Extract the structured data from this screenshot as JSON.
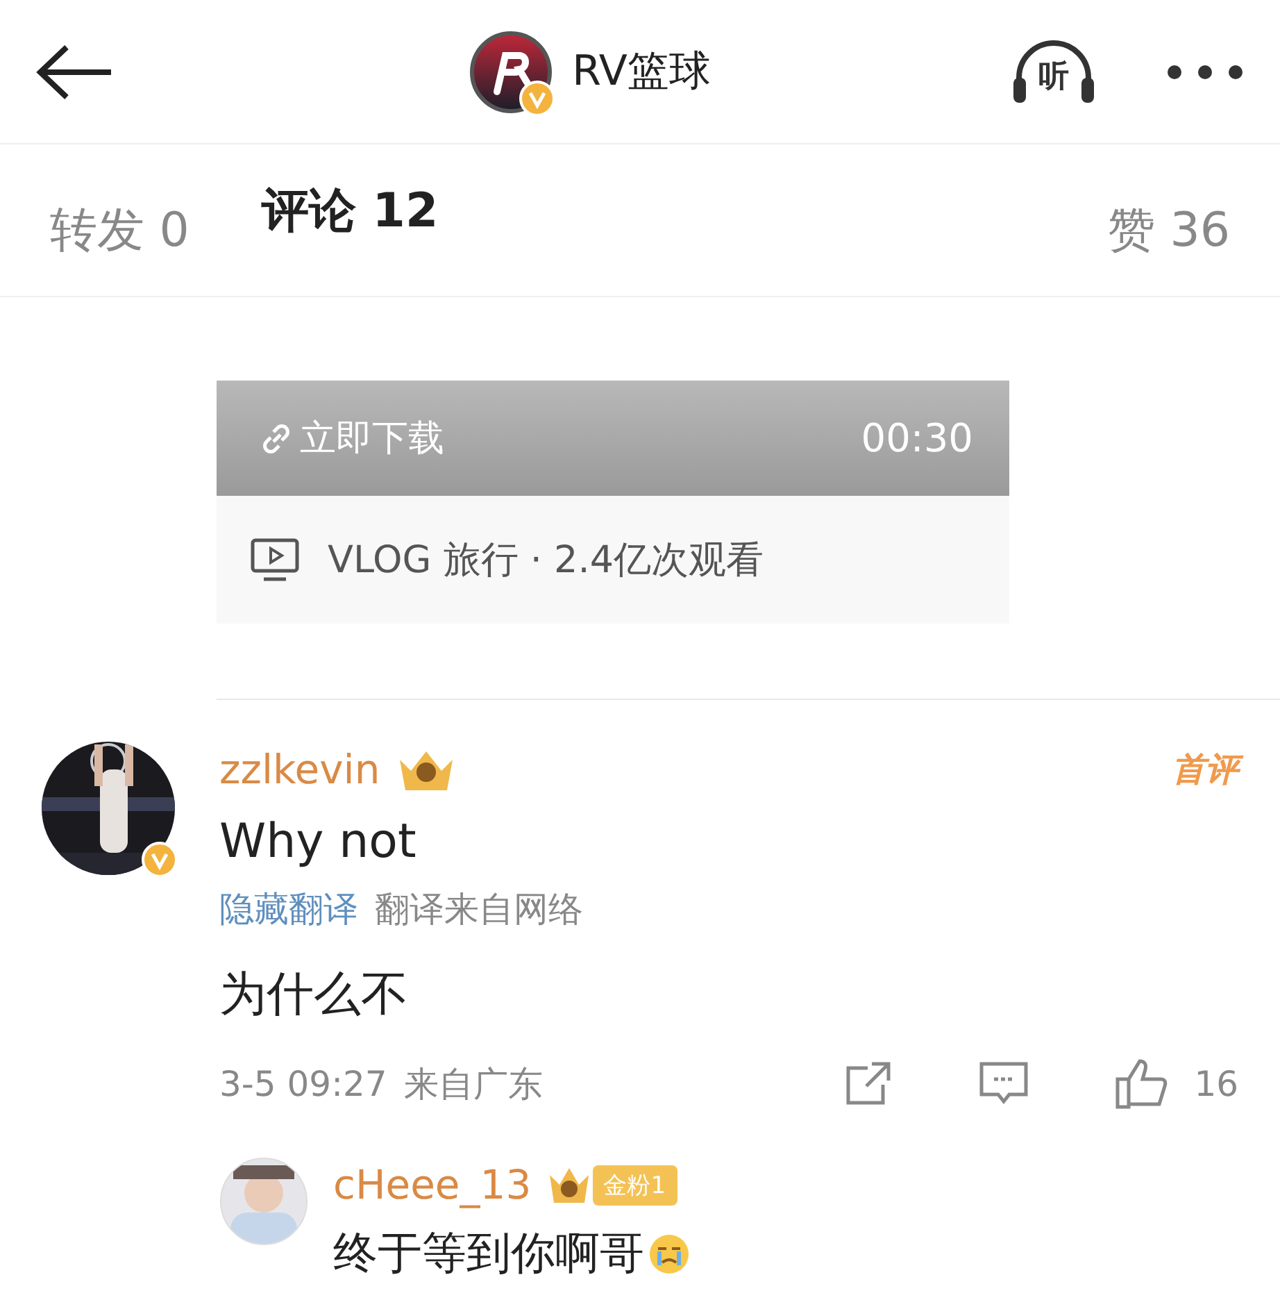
{
  "header": {
    "title": "RV篮球",
    "verified": true,
    "listen_label": "听"
  },
  "tabs": [
    {
      "label": "转发 0",
      "selected": false
    },
    {
      "label": "评论 12",
      "selected": true
    },
    {
      "label": "赞 36",
      "selected": false
    }
  ],
  "video_card": {
    "link_label": "立即下载",
    "duration": "00:30",
    "caption": "VLOG 旅行 · 2.4亿次观看"
  },
  "comments": [
    {
      "user": "zzlkevin",
      "verified": true,
      "first_comment_tag": "首评",
      "text": "Why not",
      "translation_toggle": "隐藏翻译",
      "translation_source": "翻译来自网络",
      "translated_text": "为什么不",
      "time": "3-5 09:27",
      "location": "来自广东",
      "likes": "16",
      "replies": [
        {
          "user": "cHeee_13",
          "fan_badge": "金粉1",
          "text": "终于等到你啊哥"
        }
      ]
    }
  ]
}
